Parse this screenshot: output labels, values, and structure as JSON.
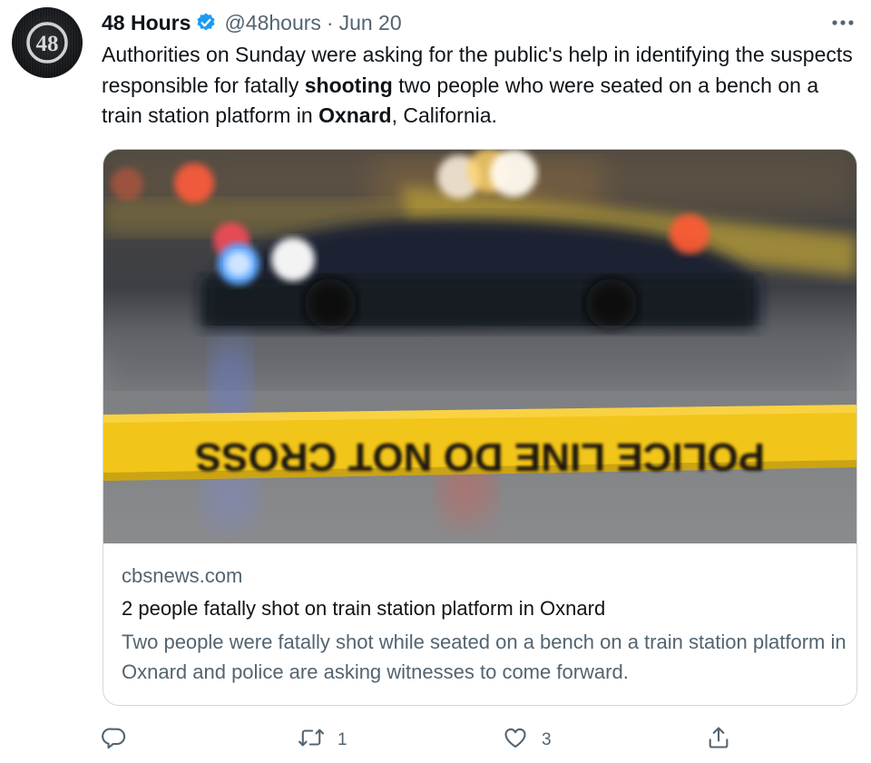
{
  "tweet": {
    "author_name": "48 Hours",
    "handle": "@48hours",
    "separator": "·",
    "date": "Jun 20",
    "avatar_text": "48",
    "text_parts": [
      "Authorities on Sunday were asking for the public's help in identifying the suspects responsible for fatally ",
      "shooting",
      " two people who were seated on a bench on a train station platform in ",
      "Oxnard",
      ", California."
    ]
  },
  "card": {
    "image_tape_text": "POLICE LINE DO NOT CROSS",
    "domain": "cbsnews.com",
    "title": "2 people fatally shot on train station platform in Oxnard",
    "description": "Two people were fatally shot while seated on a bench on a train station platform in Oxnard and police are asking witnesses to come forward."
  },
  "actions": {
    "reply_count": "",
    "retweet_count": "1",
    "like_count": "3"
  },
  "icons": {
    "verified": "verified-badge-icon",
    "more": "more-icon",
    "reply": "reply-icon",
    "retweet": "retweet-icon",
    "like": "like-icon",
    "share": "share-icon"
  },
  "colors": {
    "verified": "#1d9bf0",
    "secondary_text": "#536471",
    "primary_text": "#0f1419",
    "tape_yellow": "#f2c51a"
  }
}
